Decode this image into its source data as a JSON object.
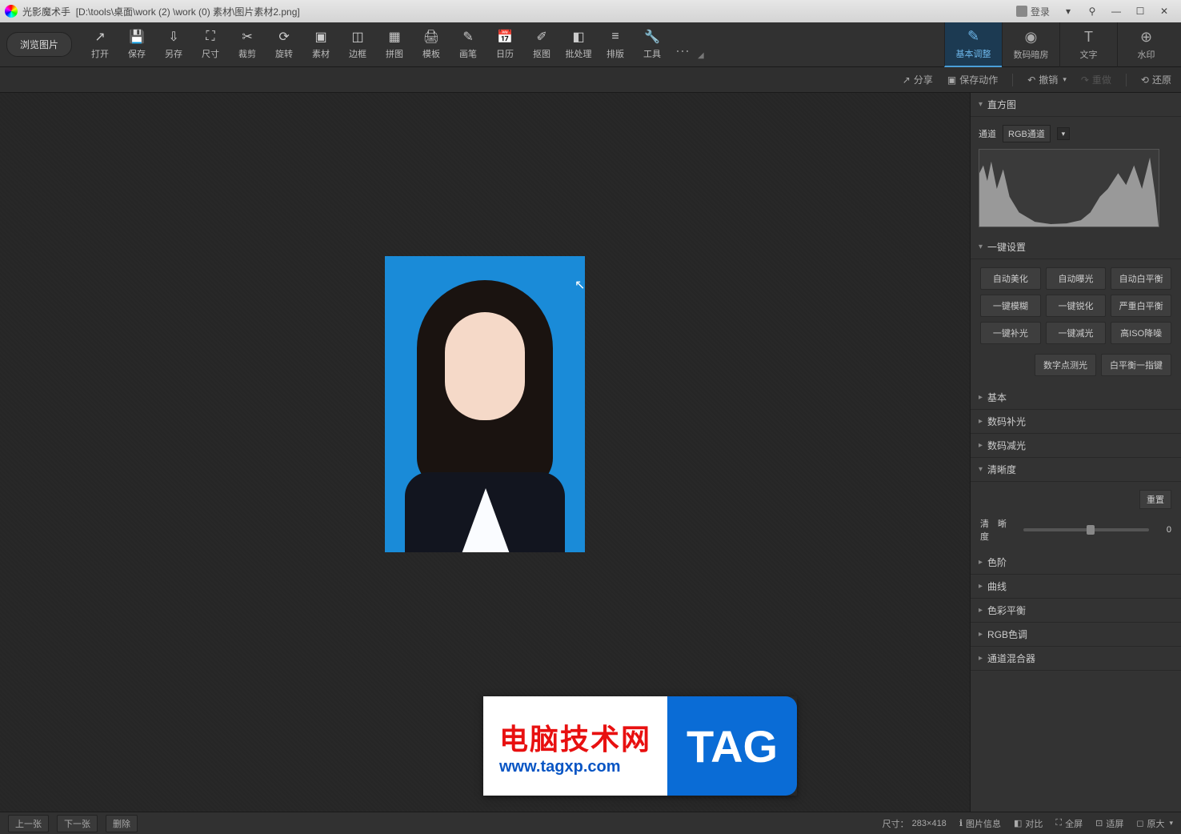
{
  "title": {
    "app": "光影魔术手",
    "path": "[D:\\tools\\桌面\\work (2) \\work (0) 素材\\图片素材2.png]",
    "login": "登录"
  },
  "toolbar": {
    "browse": "浏览图片",
    "items": [
      {
        "label": "打开",
        "icon": "↗"
      },
      {
        "label": "保存",
        "icon": "💾"
      },
      {
        "label": "另存",
        "icon": "⇩"
      },
      {
        "label": "尺寸",
        "icon": "⛶"
      },
      {
        "label": "裁剪",
        "icon": "✂"
      },
      {
        "label": "旋转",
        "icon": "⟳"
      },
      {
        "label": "素材",
        "icon": "▣"
      },
      {
        "label": "边框",
        "icon": "◫"
      },
      {
        "label": "拼图",
        "icon": "▦"
      },
      {
        "label": "模板",
        "icon": "🖨"
      },
      {
        "label": "画笔",
        "icon": "✎"
      },
      {
        "label": "日历",
        "icon": "📅"
      },
      {
        "label": "抠图",
        "icon": "✐"
      },
      {
        "label": "批处理",
        "icon": "◧"
      },
      {
        "label": "排版",
        "icon": "≡"
      },
      {
        "label": "工具",
        "icon": "🔧"
      }
    ],
    "more": "⋯"
  },
  "right_tabs": [
    {
      "label": "基本调整",
      "icon": "✎",
      "active": true
    },
    {
      "label": "数码暗房",
      "icon": "◉"
    },
    {
      "label": "文字",
      "icon": "T"
    },
    {
      "label": "水印",
      "icon": "⊕"
    }
  ],
  "sub_toolbar": {
    "share": "分享",
    "save_action": "保存动作",
    "undo": "撤销",
    "redo": "重做",
    "restore": "还原"
  },
  "panels": {
    "histogram": {
      "title": "直方图",
      "channel_label": "通道",
      "channel_value": "RGB通道"
    },
    "presets": {
      "title": "一键设置",
      "buttons": [
        "自动美化",
        "自动曝光",
        "自动白平衡",
        "一键模糊",
        "一键锐化",
        "严重白平衡",
        "一键补光",
        "一键减光",
        "高ISO降噪"
      ],
      "extra": [
        "数字点测光",
        "白平衡一指键"
      ]
    },
    "collapsed": [
      "基本",
      "数码补光",
      "数码减光"
    ],
    "clarity": {
      "title": "清晰度",
      "reset": "重置",
      "slider_label": "清 晰 度",
      "value": "0"
    },
    "collapsed2": [
      "色阶",
      "曲线",
      "色彩平衡",
      "RGB色调",
      "通道混合器"
    ]
  },
  "bottom": {
    "prev": "上一张",
    "next": "下一张",
    "delete": "删除",
    "size_label": "尺寸：",
    "size_value": "283×418",
    "info": "图片信息",
    "compare": "对比",
    "fullscreen": "全屏",
    "fit": "适屏",
    "original": "原大"
  },
  "watermark": {
    "line1": "电脑技术网",
    "line2": "www.tagxp.com",
    "tag": "TAG"
  }
}
